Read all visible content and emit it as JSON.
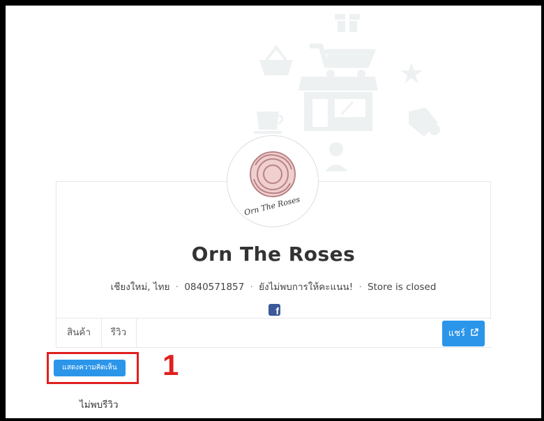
{
  "store": {
    "name": "Orn The Roses",
    "logo_text": "Orn The Roses",
    "location": "เชียงใหม่, ไทย",
    "phone": "0840571857",
    "rating_text": "ยังไม่พบการให้คะแนน!",
    "status": "Store is closed",
    "separator": "·"
  },
  "social": {
    "facebook_glyph": "f"
  },
  "tabs": [
    {
      "label": "สินค้า"
    },
    {
      "label": "รีวิว"
    }
  ],
  "share": {
    "label": "แชร์",
    "icon": "external-link-icon"
  },
  "reviews": {
    "add_comment_label": "แสดงความคิดเห็น",
    "empty_text": "ไม่พบรีวิว"
  },
  "annotation": {
    "marker": "1",
    "color": "#e02020"
  },
  "colors": {
    "primary": "#2b95e9",
    "facebook": "#3b5998",
    "illustration": "#eef1f2"
  }
}
